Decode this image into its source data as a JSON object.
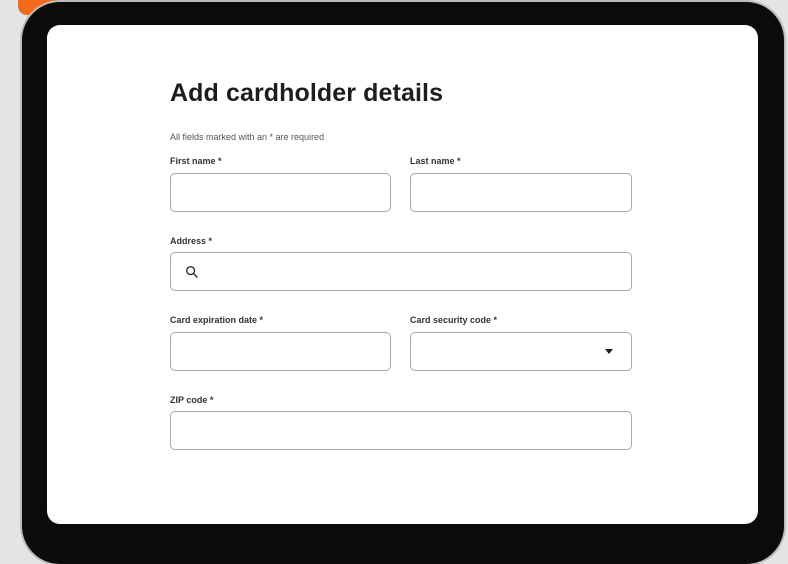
{
  "form": {
    "title": "Add cardholder details",
    "required_note": "All fields marked with an * are required",
    "first_name": {
      "label": "First name *",
      "value": ""
    },
    "last_name": {
      "label": "Last name *",
      "value": ""
    },
    "address": {
      "label": "Address *",
      "value": "",
      "icon": "search-icon"
    },
    "expiration": {
      "label": "Card expiration date *",
      "value": ""
    },
    "security_code": {
      "label": "Card security code *",
      "selected": "",
      "icon": "chevron-down-icon"
    },
    "zip": {
      "label": "ZIP code *",
      "value": ""
    }
  },
  "colors": {
    "badge": "#f26a1b",
    "device_frame": "#0b0b0b",
    "screen": "#ffffff",
    "field_border": "#a9a9a9",
    "text": "#1d1d1f"
  }
}
